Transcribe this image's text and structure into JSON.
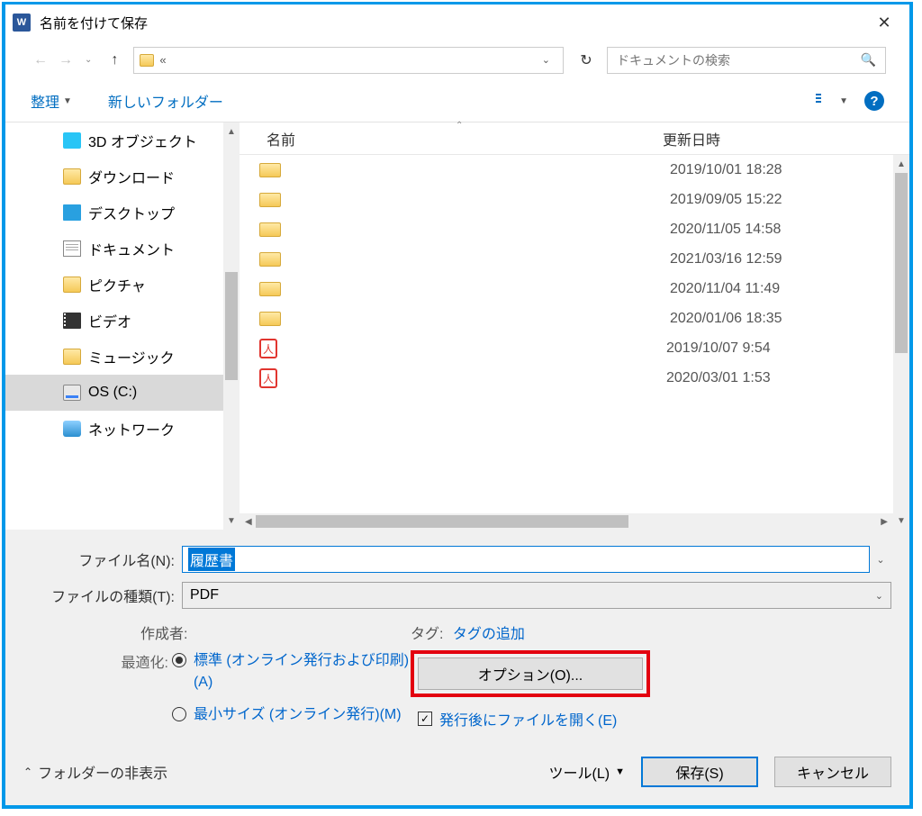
{
  "title": "名前を付けて保存",
  "nav": {
    "breadcrumb": "«",
    "search_placeholder": "ドキュメントの検索"
  },
  "toolbar": {
    "organize": "整理",
    "new_folder": "新しいフォルダー"
  },
  "sidebar": {
    "items": [
      {
        "label": "3D オブジェクト",
        "icon": "3d"
      },
      {
        "label": "ダウンロード",
        "icon": "folder"
      },
      {
        "label": "デスクトップ",
        "icon": "desktop"
      },
      {
        "label": "ドキュメント",
        "icon": "doc"
      },
      {
        "label": "ピクチャ",
        "icon": "folder"
      },
      {
        "label": "ビデオ",
        "icon": "video"
      },
      {
        "label": "ミュージック",
        "icon": "folder"
      },
      {
        "label": "OS (C:)",
        "icon": "disk",
        "selected": true
      },
      {
        "label": "ネットワーク",
        "icon": "net"
      }
    ]
  },
  "columns": {
    "name": "名前",
    "date": "更新日時"
  },
  "files": [
    {
      "type": "folder",
      "date": "2019/10/01 18:28"
    },
    {
      "type": "folder",
      "date": "2019/09/05 15:22"
    },
    {
      "type": "folder",
      "date": "2020/11/05 14:58"
    },
    {
      "type": "folder",
      "date": "2021/03/16 12:59"
    },
    {
      "type": "folder",
      "date": "2020/11/04 11:49"
    },
    {
      "type": "folder",
      "date": "2020/01/06 18:35"
    },
    {
      "type": "pdf",
      "date": "2019/10/07 9:54"
    },
    {
      "type": "pdf",
      "date": "2020/03/01 1:53"
    }
  ],
  "form": {
    "filename_label": "ファイル名(N):",
    "filename_value": "履歴書",
    "filetype_label": "ファイルの種類(T):",
    "filetype_value": "PDF",
    "author_label": "作成者:",
    "tags_label": "タグ:",
    "tags_value": "タグの追加",
    "optimize_label": "最適化:",
    "radio_standard": "標準 (オンライン発行および印刷)(A)",
    "radio_min": "最小サイズ (オンライン発行)(M)",
    "options_button": "オプション(O)...",
    "open_after_label": "発行後にファイルを開く(E)"
  },
  "footer": {
    "hide_folders": "フォルダーの非表示",
    "tools": "ツール(L)",
    "save": "保存(S)",
    "cancel": "キャンセル"
  }
}
